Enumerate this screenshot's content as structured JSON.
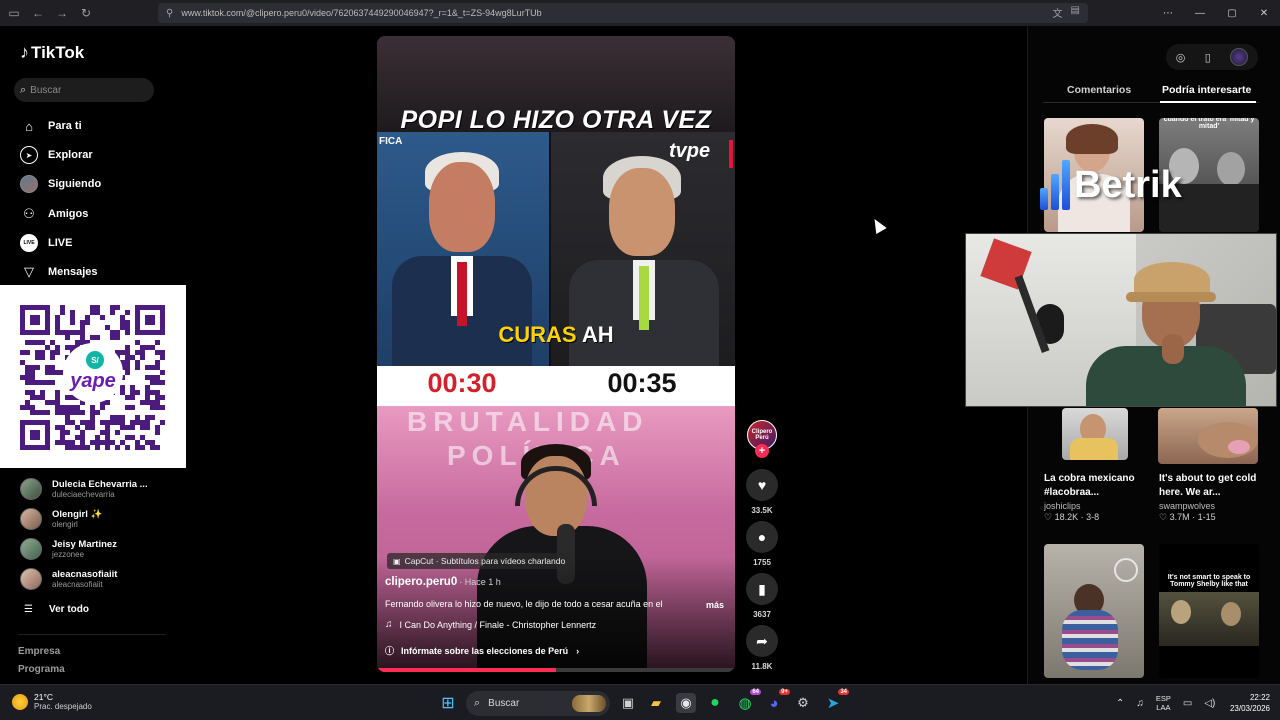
{
  "browser": {
    "url": "www.tiktok.com/@clipero.peru0/video/7620637449290046947?_r=1&_t=ZS-94wg8LurTUb",
    "nav_icons": [
      "back-arrow",
      "forward-arrow",
      "reload-icon"
    ],
    "window_controls": [
      "—",
      "▢",
      "✕"
    ]
  },
  "sidebar": {
    "logo": "TikTok",
    "search_placeholder": "Buscar",
    "nav": [
      {
        "label": "Para ti",
        "icon": "home-icon"
      },
      {
        "label": "Explorar",
        "icon": "compass-icon"
      },
      {
        "label": "Siguiendo",
        "icon": "avatar-icon"
      },
      {
        "label": "Amigos",
        "icon": "people-icon"
      },
      {
        "label": "LIVE",
        "icon": "live-icon"
      },
      {
        "label": "Mensajes",
        "icon": "send-icon"
      }
    ],
    "following": [
      {
        "name": "Dulecia Echevarria ...",
        "handle": "duleciaechevarria"
      },
      {
        "name": "Olengirl ✨",
        "handle": "olengirl"
      },
      {
        "name": "Jeisy Martinez",
        "handle": "jezzonee"
      },
      {
        "name": "aleacnasofiaiit",
        "handle": "aleacnasofiaiit"
      }
    ],
    "see_all": "Ver todo",
    "footer_links": [
      "Empresa",
      "Programa"
    ]
  },
  "qr_overlay": {
    "logo_text": "yape",
    "badge": "S/"
  },
  "video": {
    "title_overlay": "POPI LO HIZO OTRA VEZ",
    "channel_bug": "tvpe",
    "left_label": "FICA",
    "caption_yellow": "CURAS",
    "caption_white": "AH",
    "timer_left": "00:30",
    "timer_right": "00:35",
    "backdrop_line1": "BRUTALIDAD",
    "backdrop_line2": "POLÍTICA",
    "capcut": "CapCut · Subtítulos para vídeos charlando",
    "author": "clipero.peru0",
    "time": "· Hace 1 h",
    "description": "Fernando olivera lo hizo de nuevo, le dijo de todo a cesar acuña en el",
    "more": "más",
    "music": "I Can Do Anything / Finale - Christopher Lennertz",
    "info": "Infórmate sobre las elecciones de Perú",
    "progress": 0.5
  },
  "actions": {
    "avatar_text": "Clipero Perú",
    "likes": "33.5K",
    "comments": "1755",
    "saves": "3637",
    "shares": "11.8K"
  },
  "right_panel": {
    "tabs": [
      "Comentarios",
      "Podría interesarte"
    ],
    "active_tab": "Podría interesarte",
    "thumb_caption_top": "cuando el trato era 'mitad y mitad'",
    "betrik": "Betrik",
    "cards": [
      {
        "title": "La cobra mexicano #lacobraa...",
        "user": "joshiclips",
        "stats": "♡ 18.2K · 3-8"
      },
      {
        "title": "It's about to get cold here. We ar...",
        "user": "swampwolves",
        "stats": "♡ 3.7M · 1-15"
      }
    ],
    "thumb_caption_bottom": "It's not smart to speak to Tommy Shelby like that"
  },
  "taskbar": {
    "temp": "21°C",
    "weather": "Prac. despejado",
    "search": "Buscar",
    "badges": {
      "whatsapp": "64",
      "discord": "9+",
      "telegram": "34"
    },
    "lang1": "ESP",
    "lang2": "LAA",
    "time": "22:22",
    "date": "23/03/2026"
  },
  "colors": {
    "accent": "#fe2c55",
    "caption_yellow": "#ffd200",
    "timer_red": "#d4202b"
  }
}
